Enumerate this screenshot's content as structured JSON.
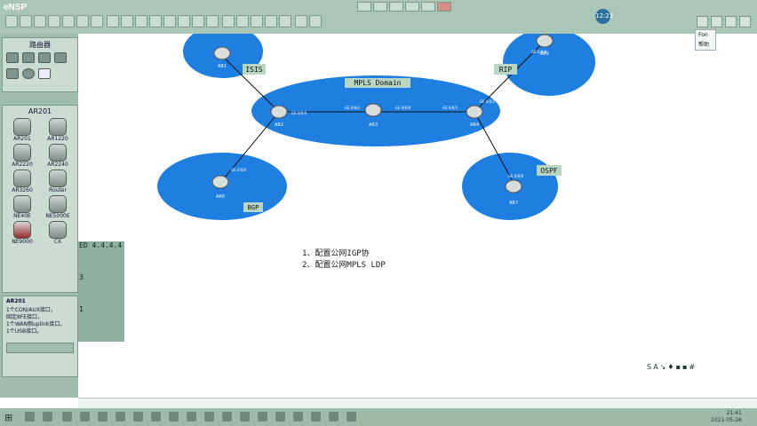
{
  "app": {
    "title": "eNSP",
    "clock_badge": "12:23"
  },
  "menu_popup": {
    "items": [
      "Fon",
      "帮助"
    ]
  },
  "left_panel": {
    "top_title": "路由器",
    "device_title": "AR201",
    "devices": [
      {
        "label": "AR201"
      },
      {
        "label": "AR1220"
      },
      {
        "label": "AR2220"
      },
      {
        "label": "AR2240"
      },
      {
        "label": "AR3260"
      },
      {
        "label": "Router"
      },
      {
        "label": "NE40E"
      },
      {
        "label": "NE5000E"
      },
      {
        "label": "NE9000"
      },
      {
        "label": "CX"
      }
    ],
    "info_title": "AR201",
    "info_lines": [
      "1个CON/AUX接口，",
      "固定8FE接口，",
      "1个WAN侧uplink接口，",
      "1个USB接口。"
    ]
  },
  "topology": {
    "domains": [
      {
        "name": "ISIS"
      },
      {
        "name": "MPLS Domain"
      },
      {
        "name": "BGP"
      },
      {
        "name": "OSPF"
      },
      {
        "name": "RIP"
      }
    ],
    "routers": [
      {
        "name": "AR1"
      },
      {
        "name": "AR2"
      },
      {
        "name": "AR3"
      },
      {
        "name": "AR4"
      },
      {
        "name": "AR5"
      },
      {
        "name": "AR6"
      },
      {
        "name": "AR7"
      }
    ],
    "ports": [
      "GE 0/0/0",
      "GE 0/0/1",
      "GE 0/0/2"
    ]
  },
  "cli": {
    "lines": [
      "ED 4.4.4.4",
      "",
      "3",
      "",
      "1"
    ]
  },
  "steps": {
    "line1": "1、配置公网IGP协",
    "line2": "2、配置公网MPLS LDP"
  },
  "system": {
    "time": "21:41",
    "date": "2021-05-26"
  },
  "colors": {
    "domain_blue": "#1e7fe0",
    "chrome_green": "#a9c6b6",
    "domain_label_bg": "#b7d6c4"
  }
}
